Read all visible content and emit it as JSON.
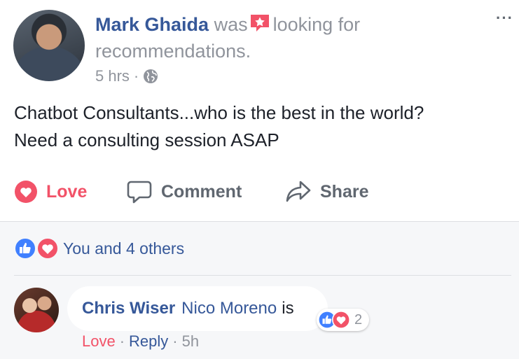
{
  "post": {
    "author": "Mark Ghaida",
    "activity_prefix": "was",
    "activity_icon": "star-flag-icon",
    "activity_text": "looking for recommendations.",
    "time": "5 hrs",
    "separator": "·",
    "privacy_icon": "globe-icon",
    "more_icon": "···",
    "text_line1": "Chatbot Consultants...who is the best in the world?",
    "text_line2": "Need a consulting session ASAP"
  },
  "actions": {
    "love_label": "Love",
    "comment_label": "Comment",
    "share_label": "Share"
  },
  "reactions": {
    "summary": "You and 4 others",
    "icons": [
      "like-icon",
      "love-icon"
    ]
  },
  "comment": {
    "author": "Chris Wiser",
    "tagged": "Nico Moreno",
    "text": "is",
    "reaction_count": "2",
    "love_label": "Love",
    "separator": "·",
    "reply_label": "Reply",
    "time": "5h"
  },
  "colors": {
    "link": "#365899",
    "love": "#f25268",
    "like": "#4080ff",
    "muted": "#90949c"
  }
}
